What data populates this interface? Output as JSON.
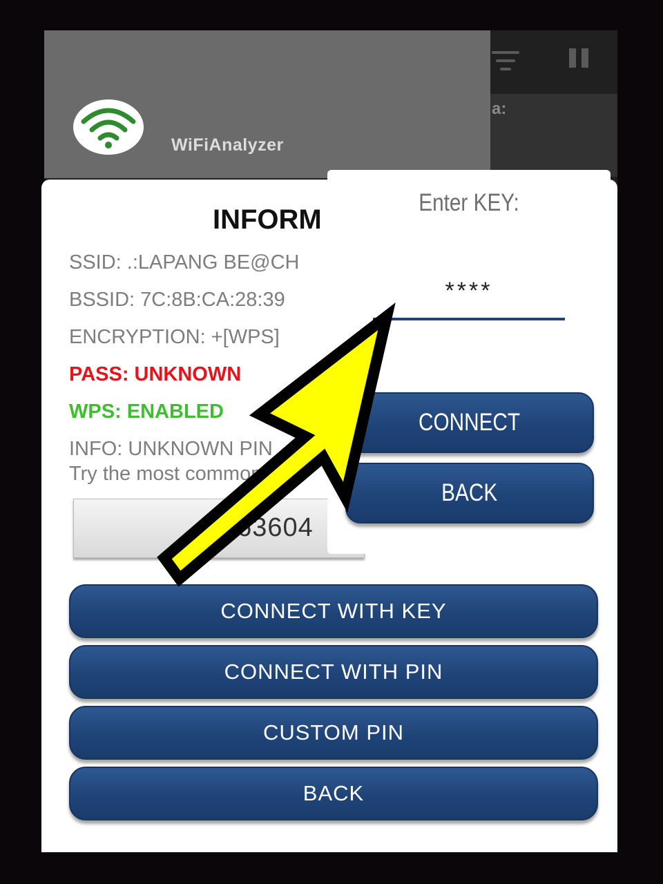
{
  "background_app": {
    "partial_label": "a:"
  },
  "app_header": {
    "title": "WiFiAnalyzer",
    "logo_icon": "wifi-icon"
  },
  "info_dialog": {
    "title": "INFORM",
    "ssid": "SSID: .:LAPANG BE@CH",
    "bssid": "BSSID: 7C:8B:CA:28:39",
    "encryption": "ENCRYPTION: +[WPS]",
    "pass": "PASS: UNKNOWN",
    "wps": "WPS: ENABLED",
    "info_line1": "INFO: UNKNOWN PIN",
    "info_line2": "Try the most common p",
    "pin_value": "263604",
    "buttons": {
      "connect_with_key": "CONNECT WITH KEY",
      "connect_with_pin": "CONNECT WITH PIN",
      "custom_pin": "CUSTOM PIN",
      "back": "BACK"
    }
  },
  "key_dialog": {
    "label": "Enter KEY:",
    "key_value": "****",
    "connect": "CONNECT",
    "back": "BACK"
  },
  "colors": {
    "button_blue": "#1f4478",
    "pass_red": "#e8131a",
    "wps_green": "#3fbf30",
    "arrow_yellow": "#ffff00"
  }
}
